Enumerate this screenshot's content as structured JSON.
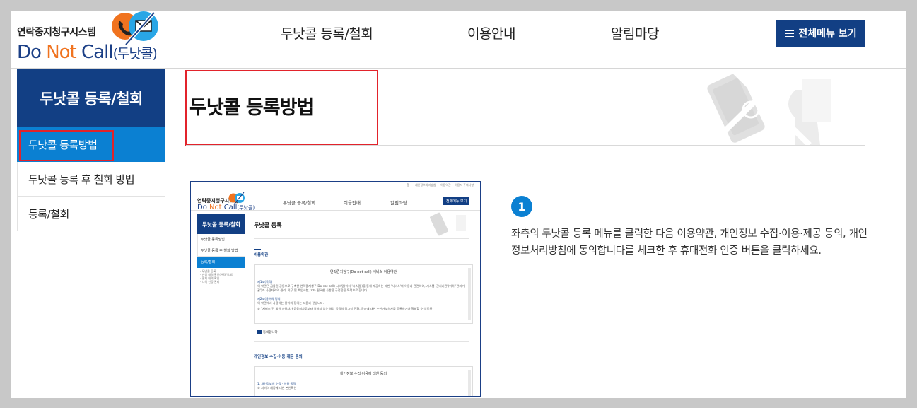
{
  "header": {
    "logo_ko": "연락중지청구시스템",
    "logo_en_do": "Do ",
    "logo_en_not": "Not ",
    "logo_en_call": "Call",
    "logo_en_sub": "(두낫콜)",
    "nav": [
      "두낫콜 등록/철회",
      "이용안내",
      "알림마당"
    ],
    "menu_button": "전체메뉴 보기"
  },
  "sidebar": {
    "title": "두낫콜 등록/철회",
    "items": [
      {
        "label": "두낫콜 등록방법",
        "active": true
      },
      {
        "label": "두낫콜 등록 후 철회 방법",
        "active": false
      },
      {
        "label": "등록/철회",
        "active": false
      }
    ]
  },
  "content": {
    "title": "두낫콜 등록방법",
    "step_number": "1",
    "step_text": "좌측의 두낫콜 등록 메뉴를 클릭한 다음 이용약관, 개인정보 수집·이용·제공 동의, 개인정보처리방침에 동의합니다를 체크한 후 휴대전화 인증 버튼을 클릭하세요."
  },
  "mini": {
    "top_links": [
      "홈",
      "개인정보처리방침",
      "이용약관",
      "이용자 주의사항"
    ],
    "logo_ko": "연락중지청구시스템",
    "logo_en_do": "Do ",
    "logo_en_not": "Not ",
    "logo_en_call": "Call",
    "logo_en_sub": "(두낫콜)",
    "nav": [
      "두낫콜 등록/철회",
      "이용안내",
      "알림마당"
    ],
    "menu_button": "전체메뉴 보기",
    "side_title": "두낫콜 등록/철회",
    "side_items": [
      "두낫콜 등록방법",
      "두낫콜 등록 후 철회 방법",
      "등록/철회"
    ],
    "side_sub": [
      "- 두낫콜 등록",
      "- 신청 내역 확인(변경/삭제)",
      "- 철회 내역 확인",
      "- 나의 인증 관리"
    ],
    "page_title": "두낫콜 등록",
    "section1": "이용약관",
    "terms_title": "연락중지청구(Do-not-call) 서비스 이용약관",
    "terms_art1": "제1조(목적)",
    "terms_art1_text": "이 약관은 금융권 공동으로 구축한 연락중지청구(Do-not-call) 시스템(이하 '시스템')을 통해 제공하는 제반 '서비스'의 이용과 관련하여, 시스템 '관리기관'(이하 '관리기관')과 사용자와의 권리, 의무 및 책임사항, 기타 필요한 사항을 규정함을 목적으로 합니다.",
    "terms_art2": "제2조(용어의 정의)",
    "terms_art2_text": "이 약관에서 사용하는 용어의 정의는 다음과 같습니다.",
    "terms_art2_item": "① \"서비스\"란 회원 사용자가 금융회사로부터 원하지 않는 영업 목적의 광고성 전화, 문자에 대한 수신거부의사를 등록하거나 철회할 수 있도록",
    "agree_label": "동의합니다",
    "section2": "개인정보 수집·이용·제공 동의",
    "privacy_title": "개인정보 수집·이용에 대한 동의",
    "privacy_item1": "1. 개인정보의 수집 · 이용 목적",
    "privacy_item2": "① 서비스 제공에 대한 본인확인"
  },
  "colors": {
    "navy": "#123f84",
    "blue": "#0b80d2",
    "orange": "#f0731f",
    "highlight_red": "#e2232b"
  }
}
